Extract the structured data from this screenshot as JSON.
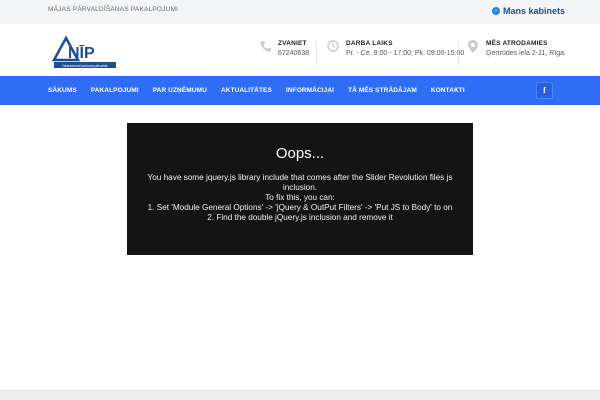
{
  "topbar": {
    "tagline": "MĀJAS PĀRVALDĪŠANAS PAKALPOJUMI",
    "cabinet_label": "Mans kabinets",
    "cabinet_icon": "arrow-circle-icon"
  },
  "logo": {
    "mark_text": "NĪP",
    "subtext": "Nekustamā īpašuma pārvalde",
    "color": "#1e4f90"
  },
  "header_info": [
    {
      "title": "ZVANIET",
      "value": "67240638",
      "icon": "phone-icon"
    },
    {
      "title": "DARBA LAIKS",
      "value": "Pr. - Ce. 9:00 - 17:00; Pk. 09:00-15:00",
      "icon": "clock-icon"
    },
    {
      "title": "MĒS ATRODAMIES",
      "value": "Ģertrūdes iela 2-11, Rīga",
      "icon": "location-pin-icon"
    }
  ],
  "nav": {
    "items": [
      "SĀKUMS",
      "PAKALPOJUMI",
      "PAR UZŅĒMUMU",
      "AKTUALITĀTES",
      "INFORMĀCIJAI",
      "TĀ MĒS STRĀDĀJAM",
      "KONTAKTI"
    ],
    "social_label": "f",
    "color": "#2f6df6"
  },
  "error": {
    "title": "Oops...",
    "line1": "You have some jquery.js library include that comes after the Slider Revolution files js",
    "line2": "inclusion.",
    "line3": "To fix this, you can:",
    "line4": "1. Set 'Module General Options' -> 'jQuery & OutPut Filters' -> 'Put JS to Body' to on",
    "line5": "2. Find the double jQuery.js inclusion and remove it"
  }
}
